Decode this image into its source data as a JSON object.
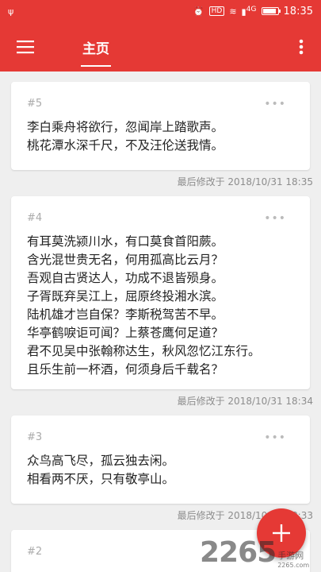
{
  "status_bar": {
    "usb_icon": "usb-icon",
    "hd_badge": "HD",
    "network": "4G",
    "battery_level": 0.8,
    "time": "18:35"
  },
  "app_bar": {
    "title": "主页",
    "menu_icon": "hamburger-menu-icon",
    "more_icon": "more-vertical-icon"
  },
  "notes": [
    {
      "num": "#5",
      "text": "李白乘舟将欲行，忽闻岸上踏歌声。\n桃花潭水深千尺，不及汪伦送我情。",
      "modified": "最后修改于 2018/10/31 18:35"
    },
    {
      "num": "#4",
      "text": "有耳莫洗颍川水，有口莫食首阳蕨。\n含光混世贵无名，何用孤高比云月？\n吾观自古贤达人，功成不退皆殒身。\n子胥既弃吴江上，屈原终投湘水滨。\n陆机雄才岂自保？李斯税驾苦不早。\n华亭鹤唳讵可闻？上蔡苍鹰何足道？\n君不见吴中张翰称达生，秋风忽忆江东行。\n且乐生前一杯酒，何须身后千载名？",
      "modified": "最后修改于 2018/10/31 18:34"
    },
    {
      "num": "#3",
      "text": "众鸟高飞尽，孤云独去闲。\n相看两不厌，只有敬亭山。",
      "modified": "最后修改于 2018/10/31 18:33"
    },
    {
      "num": "#2",
      "text": ""
    }
  ],
  "fab": {
    "label": "+",
    "icon": "plus-icon"
  },
  "watermark": {
    "digits": "2265",
    "cn": "手游网",
    "url": "2265.com"
  },
  "colors": {
    "primary": "#e53935",
    "background": "#efefef",
    "card": "#ffffff"
  }
}
